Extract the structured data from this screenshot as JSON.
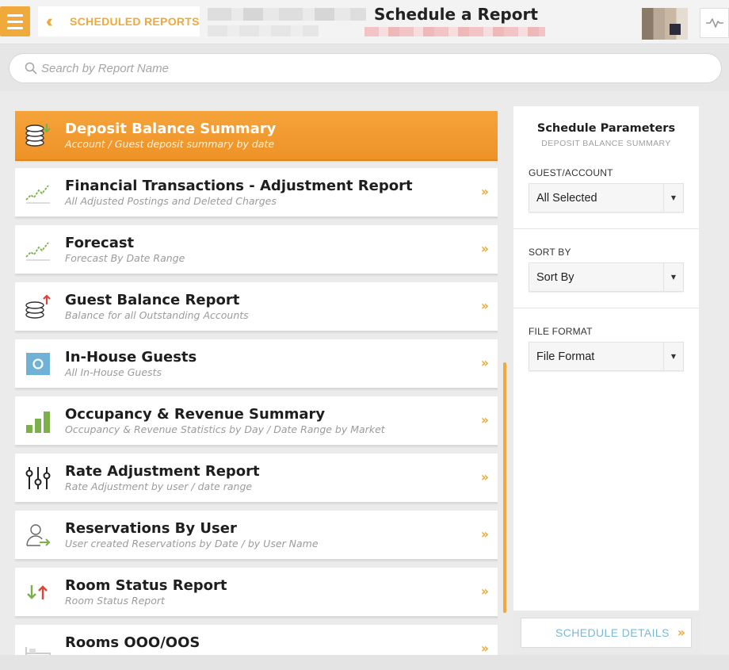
{
  "header": {
    "back_label": "SCHEDULED REPORTS",
    "page_title": "Schedule a Report"
  },
  "search": {
    "placeholder": "Search by Report Name"
  },
  "reports": [
    {
      "title": "Deposit Balance Summary",
      "subtitle": "Account / Guest deposit summary by date",
      "icon": "coins-icon",
      "active": true
    },
    {
      "title": "Financial Transactions - Adjustment Report",
      "subtitle": "All Adjusted Postings and Deleted Charges",
      "icon": "trend-line-icon"
    },
    {
      "title": "Forecast",
      "subtitle": "Forecast By Date Range",
      "icon": "trend-line-icon"
    },
    {
      "title": "Guest Balance Report",
      "subtitle": "Balance for all Outstanding Accounts",
      "icon": "coins-up-icon"
    },
    {
      "title": "In-House Guests",
      "subtitle": "All In-House Guests",
      "icon": "in-house-icon"
    },
    {
      "title": "Occupancy & Revenue Summary",
      "subtitle": "Occupancy & Revenue Statistics by Day / Date Range by Market",
      "icon": "bar-chart-icon"
    },
    {
      "title": "Rate Adjustment Report",
      "subtitle": "Rate Adjustment by user / date range",
      "icon": "sliders-icon"
    },
    {
      "title": "Reservations By User",
      "subtitle": "User created Reservations by Date / by User Name",
      "icon": "user-arrow-icon"
    },
    {
      "title": "Room Status Report",
      "subtitle": "Room Status Report",
      "icon": "up-down-arrows-icon"
    },
    {
      "title": "Rooms OOO/OOS",
      "subtitle": "",
      "icon": "bed-icon"
    }
  ],
  "panel": {
    "title": "Schedule Parameters",
    "subtitle": "DEPOSIT BALANCE SUMMARY",
    "guest_label": "GUEST/ACCOUNT",
    "guest_value": "All Selected",
    "sort_label": "SORT BY",
    "sort_value": "Sort By",
    "format_label": "FILE FORMAT",
    "format_value": "File Format",
    "details_button": "SCHEDULE DETAILS"
  },
  "colors": {
    "accent": "#f0a93b",
    "details_text": "#7ab8d6",
    "trend_green": "#7bb04b",
    "arrow_red": "#d9473b"
  }
}
